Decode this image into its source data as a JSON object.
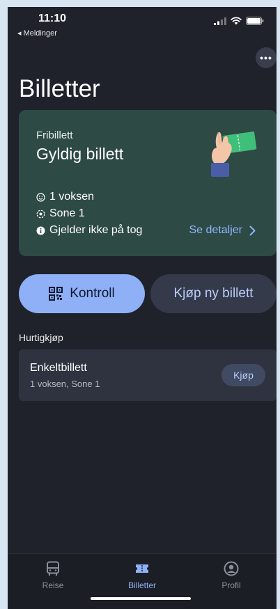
{
  "status_bar": {
    "time": "11:10",
    "back_app": "◂ Meldinger"
  },
  "header": {
    "title": "Billetter",
    "more_label": "•••"
  },
  "ticket_card": {
    "type": "Fribillett",
    "status": "Gyldig billett",
    "info": [
      {
        "icon": "person-smile-icon",
        "text": "1 voksen"
      },
      {
        "icon": "zone-icon",
        "text": "Sone 1"
      },
      {
        "icon": "info-icon",
        "text": "Gjelder ikke på tog"
      }
    ],
    "details_link": "Se detaljer"
  },
  "actions": {
    "kontroll_label": "Kontroll",
    "buy_new_label": "Kjøp ny billett"
  },
  "quick_buy": {
    "section_label": "Hurtigkjøp",
    "item": {
      "name": "Enkeltbillett",
      "description": "1 voksen, Sone 1",
      "buy_label": "Kjøp"
    }
  },
  "tabbar": {
    "tabs": [
      {
        "label": "Reise",
        "icon": "bus-icon",
        "active": false
      },
      {
        "label": "Billetter",
        "icon": "ticket-icon",
        "active": true
      },
      {
        "label": "Profil",
        "icon": "profile-icon",
        "active": false
      }
    ]
  },
  "colors": {
    "background": "#1f222a",
    "card_green": "#2e4a44",
    "accent": "#8fb0f7",
    "link": "#8db4ff"
  }
}
